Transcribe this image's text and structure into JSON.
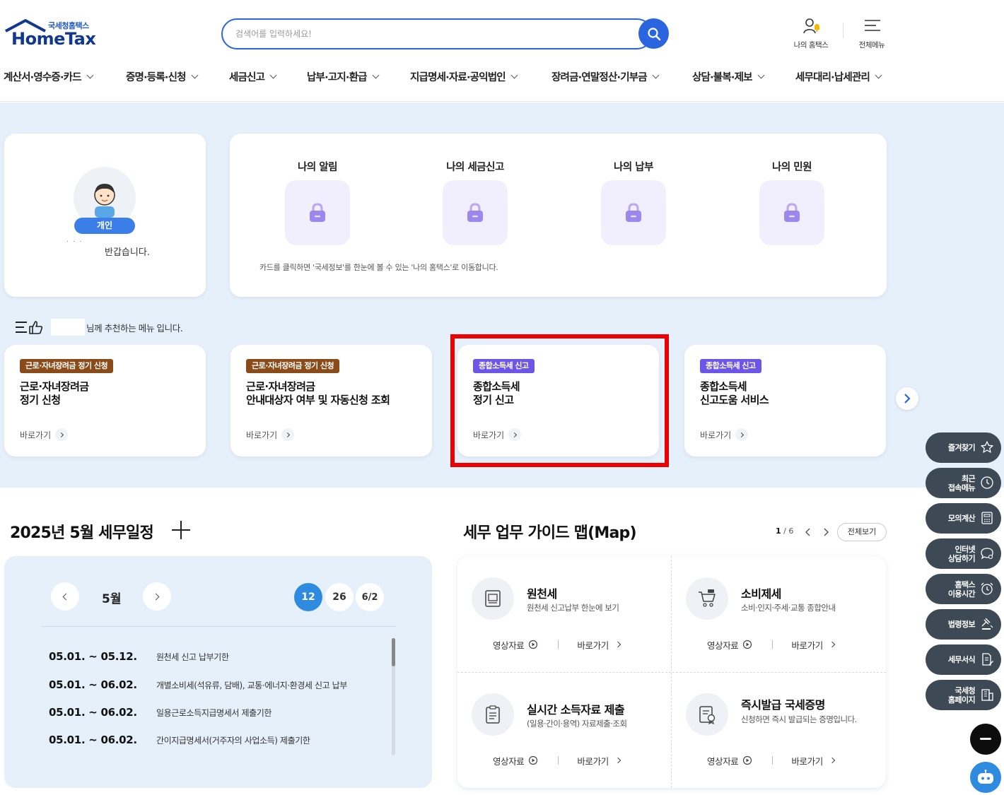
{
  "header": {
    "logo_sub": "국세청홈택스",
    "logo_main": "HomeTax",
    "search_placeholder": "검색어를 입력하세요!",
    "my_hometax_label": "나의 홈택스",
    "all_menu_label": "전체메뉴"
  },
  "nav": [
    {
      "label": "계산서·영수증·카드"
    },
    {
      "label": "증명·등록·신청"
    },
    {
      "label": "세금신고"
    },
    {
      "label": "납부·고지·환급"
    },
    {
      "label": "지급명세·자료·공익법인"
    },
    {
      "label": "장려금·연말정산·기부금"
    },
    {
      "label": "상담·불복·제보"
    },
    {
      "label": "세무대리·납세관리"
    }
  ],
  "profile": {
    "badge": "개인",
    "greeting": "반갑습니다."
  },
  "my_tax": {
    "items": [
      {
        "title": "나의 알림"
      },
      {
        "title": "나의 세금신고"
      },
      {
        "title": "나의 납부"
      },
      {
        "title": "나의 민원"
      }
    ],
    "note": "카드를 클릭하면 '국세정보'를 한눈에 볼 수 있는 '나의 홈택스'로 이동합니다."
  },
  "recommend": {
    "header_text": "님께 추천하는 메뉴 입니다.",
    "cards": [
      {
        "tag": "근로·자녀장려금 정기 신청",
        "title_line1": "근로·자녀장려금",
        "title_line2": "정기 신청",
        "link": "바로가기",
        "tag_color": "#8a4b18"
      },
      {
        "tag": "근로·자녀장려금 정기 신청",
        "title_line1": "근로·자녀장려금",
        "title_line2": "안내대상자 여부 및 자동신청 조회",
        "link": "바로가기",
        "tag_color": "#8a4b18"
      },
      {
        "tag": "종합소득세 신고",
        "title_line1": "종합소득세",
        "title_line2": "정기 신고",
        "link": "바로가기",
        "tag_color": "#6c55e8"
      },
      {
        "tag": "종합소득세 신고",
        "title_line1": "종합소득세",
        "title_line2": "신고도움 서비스",
        "link": "바로가기",
        "tag_color": "#6c55e8"
      }
    ]
  },
  "schedule": {
    "title": "2025년 5월 세무일정",
    "month": "5월",
    "days": [
      "12",
      "26",
      "6/2"
    ],
    "rows": [
      {
        "date": "05.01. ~ 05.12.",
        "desc": "원천세 신고 납부기한"
      },
      {
        "date": "05.01. ~ 06.02.",
        "desc": "개별소비세(석유류, 담배), 교통·에너지·환경세 신고 납부"
      },
      {
        "date": "05.01. ~ 06.02.",
        "desc": "일용근로소득지급명세서 제출기한"
      },
      {
        "date": "05.01. ~ 06.02.",
        "desc": "간이지급명세서(거주자의 사업소득) 제출기한"
      }
    ]
  },
  "guide": {
    "title": "세무 업무 가이드 맵(Map)",
    "page_current": "1",
    "page_total": "/ 6",
    "view_all": "전체보기",
    "video_label": "영상자료",
    "go_label": "바로가기",
    "cells": [
      {
        "name": "원천세",
        "desc": "원천세 신고납부 한눈에 보기"
      },
      {
        "name": "소비제세",
        "desc": "소비·인지·주세·교통 종합안내"
      },
      {
        "name": "실시간 소득자료 제출",
        "desc": "(일용·간이·용역) 자료제출·조회"
      },
      {
        "name": "즉시발급 국세증명",
        "desc": "신청하면 즉시 발급되는 증명입니다."
      }
    ]
  },
  "quick_menu": [
    {
      "line1": "즐겨찾기",
      "line2": "",
      "icon": "star-icon"
    },
    {
      "line1": "최근",
      "line2": "접속메뉴",
      "icon": "clock-icon"
    },
    {
      "line1": "모의계산",
      "line2": "",
      "icon": "calculator-icon"
    },
    {
      "line1": "인터넷",
      "line2": "상담하기",
      "icon": "chat-icon"
    },
    {
      "line1": "홈택스",
      "line2": "이용시간",
      "icon": "alarm-clock-icon"
    },
    {
      "line1": "법령정보",
      "line2": "",
      "icon": "gavel-icon"
    },
    {
      "line1": "세무서식",
      "line2": "",
      "icon": "document-edit-icon"
    },
    {
      "line1": "국세청",
      "line2": "홈페이지",
      "icon": "building-icon"
    }
  ]
}
